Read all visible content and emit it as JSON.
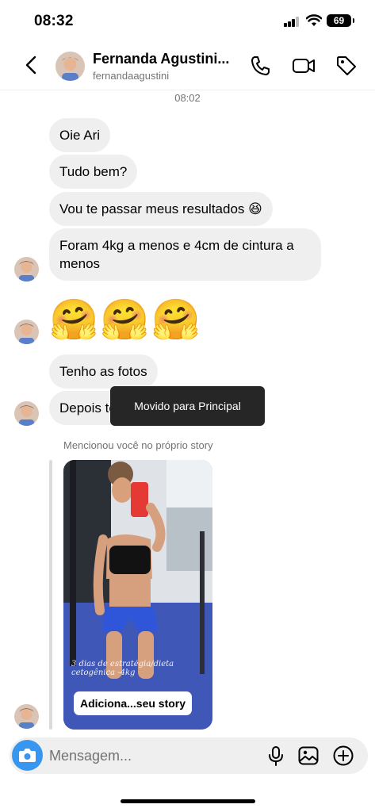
{
  "status_bar": {
    "time": "08:32",
    "battery": "69",
    "icons": [
      "signal-icon",
      "wifi-icon",
      "battery-icon"
    ]
  },
  "header": {
    "name": "Fernanda Agustini...",
    "username": "fernandaagustini",
    "icons": [
      "back-icon",
      "phone-icon",
      "video-icon",
      "tag-icon"
    ]
  },
  "conversation": {
    "timestamp": "08:02",
    "messages": [
      {
        "text": "Oie Ari"
      },
      {
        "text": "Tudo bem?"
      },
      {
        "text": "Vou te passar meus resultados 😆"
      },
      {
        "text": "Foram 4kg a menos e 4cm de cintura a menos"
      },
      {
        "text": "🤗🤗🤗"
      },
      {
        "text": "Tenho as fotos"
      },
      {
        "text": "Depois te"
      }
    ]
  },
  "toast": {
    "text": "Movido para Principal"
  },
  "story": {
    "caption": "Mencionou você no próprio story",
    "overlay_text": "3 dias de estratégia/dieta cetogênica -4kg",
    "button_label": "Adiciona...seu story"
  },
  "composer": {
    "placeholder": "Mensagem...",
    "icons": [
      "camera-icon",
      "microphone-icon",
      "gallery-icon",
      "plus-icon"
    ]
  },
  "colors": {
    "accent": "#3797f0",
    "bubble": "#efefef",
    "secondary_text": "#737373",
    "toast": "#262626"
  }
}
